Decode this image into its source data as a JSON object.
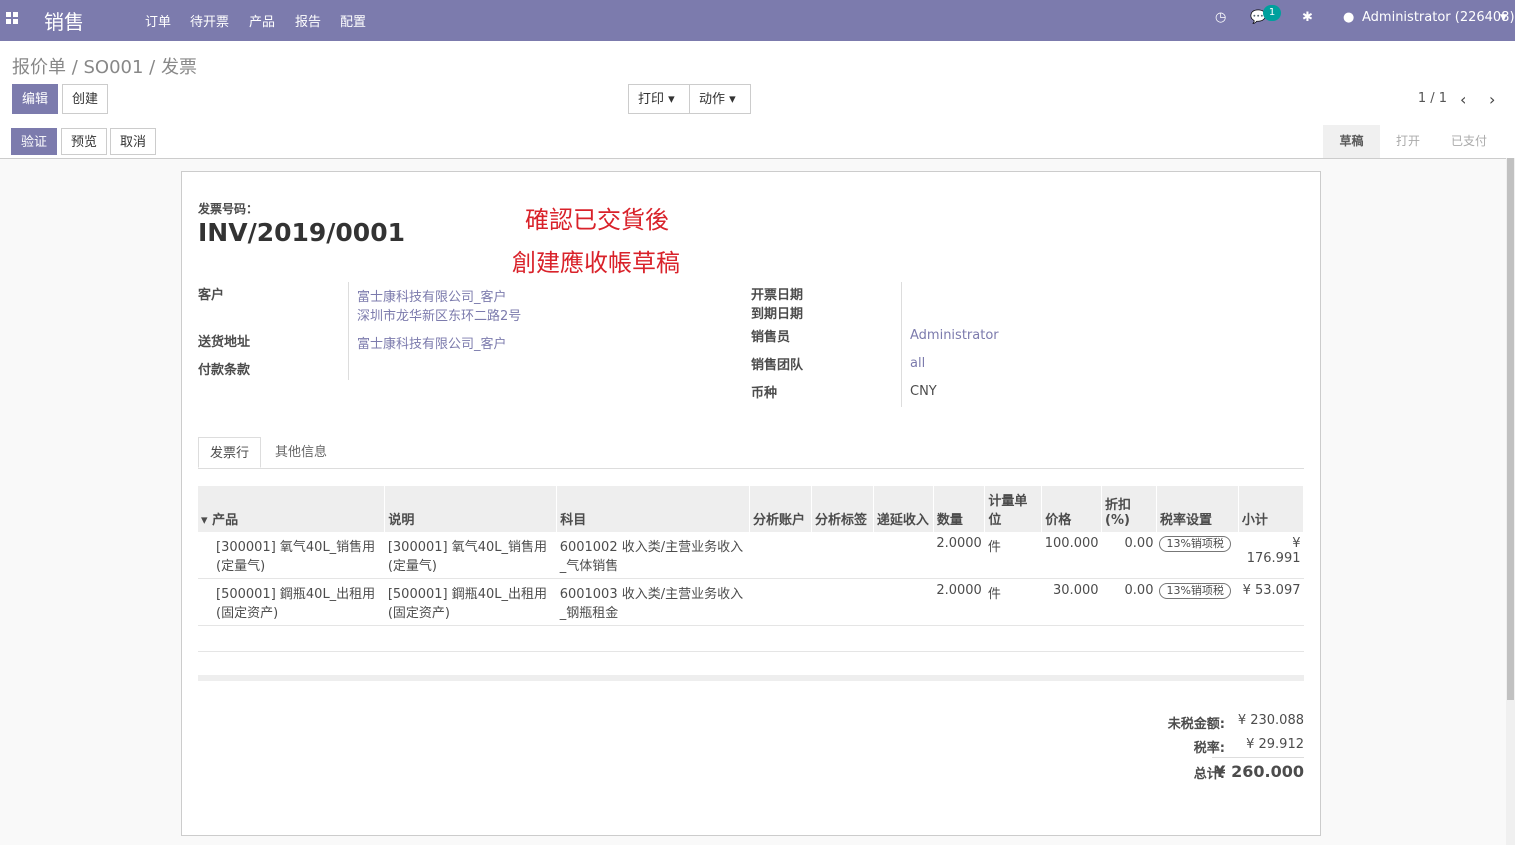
{
  "app": "销售",
  "menu": [
    "订单",
    "待开票",
    "产品",
    "报告",
    "配置"
  ],
  "badge": "1",
  "user": "Administrator (226408)",
  "breadcrumb": "报价单 / SO001 / 发票",
  "buttons": {
    "edit": "编辑",
    "create": "创建",
    "print": "打印",
    "action": "动作",
    "validate": "验证",
    "preview": "预览",
    "cancel": "取消"
  },
  "pager": "1 / 1",
  "stages": [
    "草稿",
    "打开",
    "已支付"
  ],
  "invoice": {
    "number_label": "发票号码：",
    "number": "INV/2019/0001",
    "note1": "確認已交貨後",
    "note2": "創建應收帳草稿",
    "customer_label": "客户",
    "customer_name": "富士康科技有限公司_客户",
    "customer_addr": "深圳市龙华新区东环二路2号",
    "delivery_label": "送货地址",
    "delivery": "富士康科技有限公司_客户",
    "terms_label": "付款条款",
    "date_label": "开票日期",
    "due_label": "到期日期",
    "salesperson_label": "销售员",
    "salesperson": "Administrator",
    "team_label": "销售团队",
    "team": "all",
    "currency_label": "币种",
    "currency": "CNY"
  },
  "tabs": [
    "发票行",
    "其他信息"
  ],
  "table": {
    "headers": [
      "产品",
      "说明",
      "科目",
      "分析账户",
      "分析标签",
      "递延收入",
      "数量",
      "计量单位",
      "价格",
      "折扣 (%)",
      "税率设置",
      "小计"
    ],
    "rows": [
      [
        "[300001] 氧气40L_销售用 (定量气)",
        "[300001] 氧气40L_销售用 (定量气)",
        "6001002 收入类/主营业务收入_气体销售",
        "",
        "",
        "",
        "2.0000",
        "件",
        "100.000",
        "0.00",
        "13%销项税",
        "¥ 176.991"
      ],
      [
        "[500001] 鋼瓶40L_出租用 (固定资产)",
        "[500001] 鋼瓶40L_出租用 (固定资产)",
        "6001003 收入类/主营业务收入_钢瓶租金",
        "",
        "",
        "",
        "2.0000",
        "件",
        "30.000",
        "0.00",
        "13%销项税",
        "¥ 53.097"
      ]
    ]
  },
  "totals": {
    "untaxed_label": "未税金额:",
    "untaxed": "¥ 230.088",
    "tax_label": "税率:",
    "tax": "¥ 29.912",
    "total_label": "总计:",
    "total": "¥ 260.000"
  }
}
